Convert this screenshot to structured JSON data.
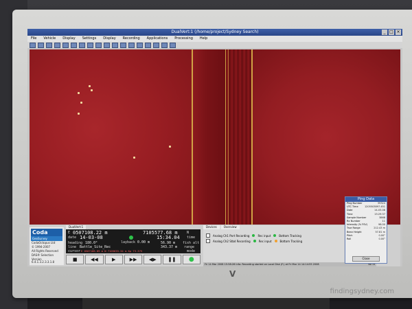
{
  "window": {
    "title": "DualVert:1 (/home/project/Sydney Search)"
  },
  "menu": [
    "File",
    "Vehicle",
    "Display",
    "Settings",
    "Display",
    "Recording",
    "Applications",
    "Processing",
    "Help"
  ],
  "panel": {
    "tab": "DualVert:1",
    "logo": {
      "line1": "Coda",
      "line2": "GeoSurvey",
      "small1": "CodaOctopus Ltd",
      "small2": "© 1994-2007",
      "small3": "All Rights Reserved",
      "brand": "DAS® Selection",
      "version": "Version 6.4.1.3.2.3.3.1.8"
    },
    "nav": {
      "e_label": "E",
      "easting": "0507108.22 m",
      "northing": "7105577.68 m",
      "n_label": "N",
      "date_label": "date",
      "date": "14-03-08",
      "time": "15:34.04",
      "time_label": "time",
      "layback_label": "layback",
      "layback": "0.00 m",
      "heading_label": "heading",
      "heading": "180.0°",
      "fishalt": "56.90 m",
      "fishalt_label": "fish alt",
      "line_label": "line",
      "line": "Battle_Site_Rec",
      "range": "343.37 m",
      "range_label": "range",
      "cursor_label": "cursor",
      "cursor": "E 0507168.89 m  N 7105635.34 m  Kp  73.375",
      "mode_label": "mode"
    },
    "controls": [
      "■",
      "◀◀",
      "▶",
      "▶▶",
      "◀▶",
      "❚❚",
      "●"
    ]
  },
  "right": {
    "tabs": [
      "Devices",
      "Overview"
    ],
    "rows": [
      {
        "label": "Analog Ch1 Port Recording",
        "rec": "Rec input",
        "track": "Bottom Tracking"
      },
      {
        "label": "Analog Ch2 Stbd Recording",
        "rec": "Rec input",
        "track": "Bottom Tracking"
      }
    ],
    "status": "Fri 14 Mar 2008 15:58:26 Info: Recording started on Local Disk (F:) at Fri Mar 14 14:14:55 2008",
    "status_right": "Ko Tk"
  },
  "ping": {
    "title": "Ping Data",
    "rows": [
      {
        "k": "Ping Number",
        "v": "39324"
      },
      {
        "k": "UTC Time",
        "v": "1205503897.451"
      },
      {
        "k": "Date",
        "v": "14-03-08"
      },
      {
        "k": "Time",
        "v": "15:29:37"
      },
      {
        "k": "Sample Number",
        "v": "3868"
      },
      {
        "k": "Rx Number",
        "v": "11"
      },
      {
        "k": "Intensity (% FSV)",
        "v": "98.00"
      },
      {
        "k": "True Range",
        "v": "212.43 m"
      },
      {
        "k": "Bean Height",
        "v": "57.81 m"
      },
      {
        "k": "Pitch",
        "v": "0.00°"
      },
      {
        "k": "Roll",
        "v": "0.00°"
      }
    ],
    "close": "Close"
  },
  "monitor": {
    "brand": "V"
  },
  "watermark": "findingsydney.com",
  "colors": {
    "sonar": "#8d1a1f",
    "trace": "#d9b44a",
    "titlebar": "#2a4688"
  }
}
